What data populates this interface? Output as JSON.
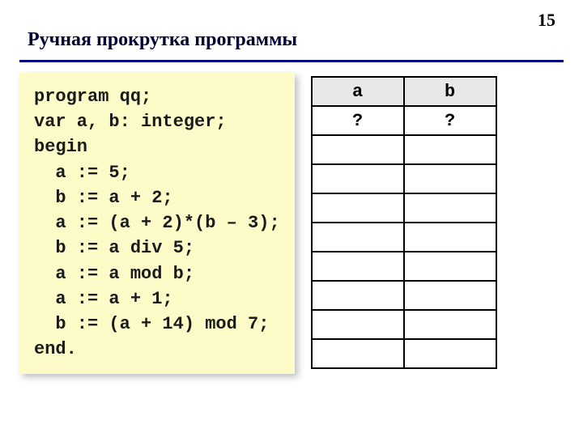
{
  "page_number": "15",
  "title": "Ручная прокрутка программы",
  "code": {
    "lines": [
      "program qq;",
      "var a, b: integer;",
      "begin",
      "  a := 5;",
      "  b := a + 2;",
      "  a := (a + 2)*(b – 3);",
      "  b := a div 5;",
      "  a := a mod b;",
      "  a := a + 1;",
      "  b := (a + 14) mod 7;",
      "end."
    ]
  },
  "table": {
    "headers": [
      "a",
      "b"
    ],
    "rows": [
      [
        "?",
        "?"
      ],
      [
        "",
        ""
      ],
      [
        "",
        ""
      ],
      [
        "",
        ""
      ],
      [
        "",
        ""
      ],
      [
        "",
        ""
      ],
      [
        "",
        ""
      ],
      [
        "",
        ""
      ],
      [
        "",
        ""
      ]
    ]
  }
}
